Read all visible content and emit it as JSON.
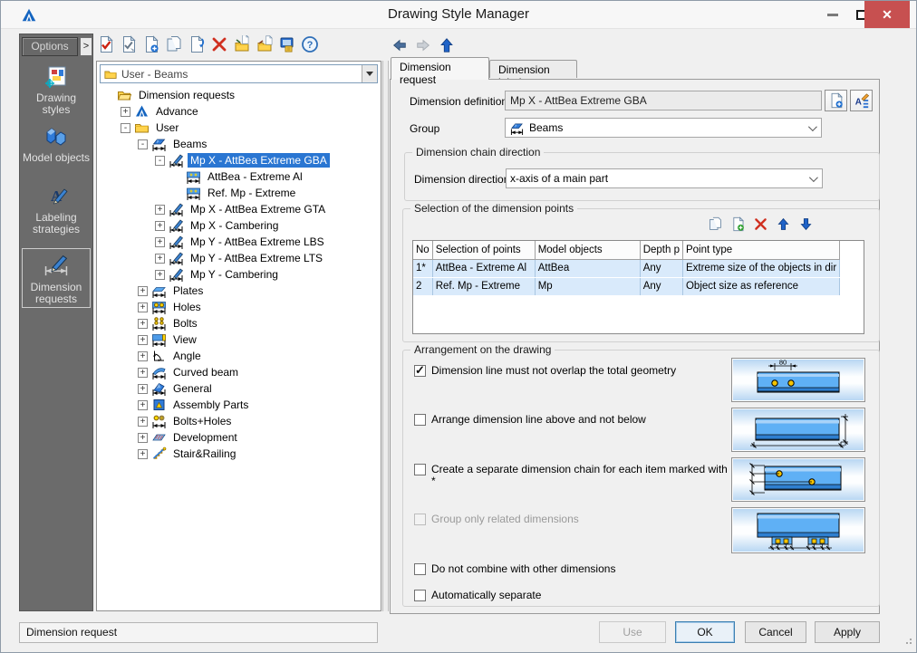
{
  "window": {
    "title": "Drawing Style Manager"
  },
  "sidebar": {
    "options_label": "Options",
    "options_expander": ">",
    "items": [
      {
        "label": "Drawing styles"
      },
      {
        "label": "Model objects"
      },
      {
        "label": "Labeling strategies"
      },
      {
        "label": "Dimension requests",
        "selected": true
      }
    ]
  },
  "toolbar": {
    "icons": [
      "confirm-style",
      "check-style",
      "new-style",
      "copy-style",
      "paste-style",
      "delete-style",
      "import-style",
      "export-style",
      "transfer-style",
      "help"
    ]
  },
  "nav": {
    "icons": [
      "back",
      "forward",
      "up"
    ]
  },
  "tree": {
    "path_value": "User - Beams",
    "items": [
      {
        "level": 0,
        "expander": "",
        "icon": "folder-open",
        "label": "Dimension requests"
      },
      {
        "level": 1,
        "expander": "+",
        "icon": "advance",
        "label": "Advance"
      },
      {
        "level": 1,
        "expander": "-",
        "icon": "folder",
        "label": "User"
      },
      {
        "level": 2,
        "expander": "-",
        "icon": "beam",
        "label": "Beams"
      },
      {
        "level": 3,
        "expander": "-",
        "icon": "dim-pencil",
        "label": "Mp X - AttBea Extreme GBA",
        "selected": true
      },
      {
        "level": 4,
        "expander": "",
        "icon": "dim-bar",
        "label": "AttBea - Extreme Al"
      },
      {
        "level": 4,
        "expander": "",
        "icon": "dim-bar",
        "label": "Ref. Mp - Extreme"
      },
      {
        "level": 3,
        "expander": "+",
        "icon": "dim-pencil",
        "label": "Mp X - AttBea Extreme GTA"
      },
      {
        "level": 3,
        "expander": "+",
        "icon": "dim-pencil",
        "label": "Mp X - Cambering"
      },
      {
        "level": 3,
        "expander": "+",
        "icon": "dim-pencil",
        "label": "Mp Y - AttBea Extreme LBS"
      },
      {
        "level": 3,
        "expander": "+",
        "icon": "dim-pencil",
        "label": "Mp Y - AttBea Extreme LTS"
      },
      {
        "level": 3,
        "expander": "+",
        "icon": "dim-pencil",
        "label": "Mp Y - Cambering"
      },
      {
        "level": 2,
        "expander": "+",
        "icon": "plate",
        "label": "Plates"
      },
      {
        "level": 2,
        "expander": "+",
        "icon": "holes",
        "label": "Holes"
      },
      {
        "level": 2,
        "expander": "+",
        "icon": "bolts",
        "label": "Bolts"
      },
      {
        "level": 2,
        "expander": "+",
        "icon": "view",
        "label": "View"
      },
      {
        "level": 2,
        "expander": "+",
        "icon": "angle",
        "label": "Angle"
      },
      {
        "level": 2,
        "expander": "+",
        "icon": "curved",
        "label": "Curved beam"
      },
      {
        "level": 2,
        "expander": "+",
        "icon": "general",
        "label": "General"
      },
      {
        "level": 2,
        "expander": "+",
        "icon": "assembly",
        "label": "Assembly Parts"
      },
      {
        "level": 2,
        "expander": "+",
        "icon": "bolts-holes",
        "label": "Bolts+Holes"
      },
      {
        "level": 2,
        "expander": "+",
        "icon": "development",
        "label": "Development"
      },
      {
        "level": 2,
        "expander": "+",
        "icon": "stair",
        "label": "Stair&Railing"
      }
    ]
  },
  "tabs": [
    {
      "label": "Dimension request",
      "active": true
    },
    {
      "label": "Dimension label",
      "active": false
    }
  ],
  "form": {
    "dimension_definition": {
      "label": "Dimension definition",
      "value": "Mp X - AttBea Extreme GBA"
    },
    "group": {
      "label": "Group",
      "value": "Beams"
    },
    "chain_direction": {
      "title": "Dimension chain direction",
      "direction_label": "Dimension direction",
      "direction_value": "x-axis of a main part"
    },
    "points": {
      "title": "Selection of the dimension points",
      "toolbar_icons": [
        "copy-row",
        "add-row",
        "delete-row",
        "move-up",
        "move-down"
      ],
      "columns": [
        "No",
        "Selection of points",
        "Model objects",
        "Depth p",
        "Point type"
      ],
      "rows": [
        [
          "1*",
          "AttBea - Extreme Al",
          "AttBea",
          "Any",
          "Extreme size of the objects in dir"
        ],
        [
          "2",
          "Ref. Mp - Extreme",
          "Mp",
          "Any",
          "Object size as reference"
        ]
      ]
    },
    "arrangement": {
      "title": "Arrangement on the drawing",
      "checkboxes": [
        {
          "label": "Dimension line must not overlap the total geometry",
          "checked": true,
          "disabled": false
        },
        {
          "label": "Arrange dimension line above and not below",
          "checked": false,
          "disabled": false
        },
        {
          "label": "Create a separate dimension chain for each item marked with *",
          "checked": false,
          "disabled": false
        },
        {
          "label": "Group only related dimensions",
          "checked": false,
          "disabled": true
        },
        {
          "label": "Do not combine with other dimensions",
          "checked": false,
          "disabled": false
        },
        {
          "label": "Automatically separate",
          "checked": false,
          "disabled": false
        }
      ]
    },
    "previews": [
      {
        "name": "no-overlap-preview",
        "dim_label": "80"
      },
      {
        "name": "above-line-preview"
      },
      {
        "name": "separate-chain-preview"
      },
      {
        "name": "group-related-preview"
      }
    ]
  },
  "footer": {
    "status": "Dimension request",
    "use_label": "Use",
    "ok_label": "OK",
    "cancel_label": "Cancel",
    "apply_label": "Apply"
  },
  "colors": {
    "accent_blue": "#2a76d2",
    "close_red": "#c75050",
    "row_blue": "#d9eafb",
    "beam_blue": "#5fb0f5"
  }
}
